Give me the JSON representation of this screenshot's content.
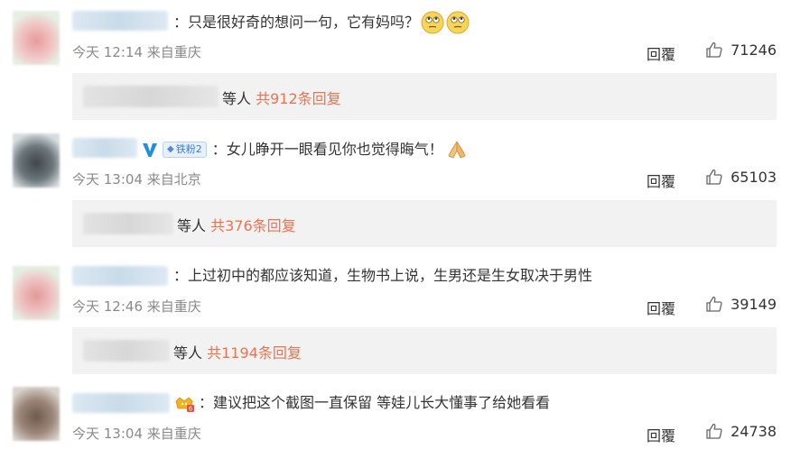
{
  "comments": [
    {
      "text": "：只是很好奇的想问一句，它有妈吗？",
      "emoji": [
        "face-rolling-eyes-icon",
        "face-rolling-eyes-icon"
      ],
      "time": "今天 12:14",
      "location": "来自重庆",
      "reply_label": "回覆",
      "likes": "71246",
      "replies": {
        "prefix": "等人 ",
        "link": "共912条回复"
      },
      "avatar_color": "#f0c0c0"
    },
    {
      "badge_v": "V",
      "fan_badge": "铁粉2",
      "text": "：女儿睁开一眼看见你也觉得晦气！",
      "emoji": [
        "praying-hands-icon"
      ],
      "time": "今天 13:04",
      "location": "来自北京",
      "reply_label": "回覆",
      "likes": "65103",
      "replies": {
        "prefix": "等人 ",
        "link": "共376条回复"
      },
      "avatar_color": "#555e63"
    },
    {
      "text": "：上过初中的都应该知道，生物书上说，生男还是生女取决于男性",
      "time": "今天 12:46",
      "location": "来自重庆",
      "reply_label": "回覆",
      "likes": "39149",
      "replies": {
        "prefix": "等人 ",
        "link": "共1194条回复"
      },
      "avatar_color": "#e9b8b8"
    },
    {
      "text": "：建议把这个截图一直保留 等娃儿长大懂事了给她看看",
      "time": "今天 13:04",
      "location": "来自重庆",
      "reply_label": "回覆",
      "likes": "24738",
      "avatar_color": "#8a7467"
    }
  ],
  "colors": {
    "link": "#eb7350",
    "meta": "#8a8a8a",
    "reply_bg": "#f2f2f2"
  }
}
